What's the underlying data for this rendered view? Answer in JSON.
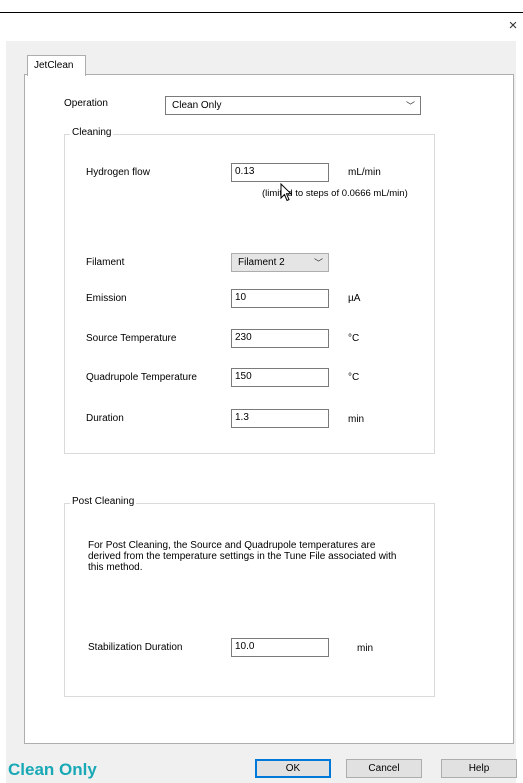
{
  "window": {
    "close_symbol": "×"
  },
  "tabs": [
    {
      "label": "JetClean"
    }
  ],
  "operation": {
    "label": "Operation",
    "value": "Clean Only"
  },
  "cleaning": {
    "title": "Cleaning",
    "hydrogen_flow": {
      "label": "Hydrogen flow",
      "value": "0.13",
      "unit": "mL/min",
      "note": "(limited to steps of 0.0666 mL/min)"
    },
    "filament": {
      "label": "Filament",
      "value": "Filament 2"
    },
    "emission": {
      "label": "Emission",
      "value": "10",
      "unit": "µA"
    },
    "source_temperature": {
      "label": "Source Temperature",
      "value": "230",
      "unit": "°C"
    },
    "quadrupole_temperature": {
      "label": "Quadrupole Temperature",
      "value": "150",
      "unit": "°C"
    },
    "duration": {
      "label": "Duration",
      "value": "1.3",
      "unit": "min"
    }
  },
  "post_cleaning": {
    "title": "Post Cleaning",
    "description": "For Post Cleaning, the Source and Quadrupole temperatures are derived from the temperature settings in the Tune File associated with this method.",
    "stabilization": {
      "label": "Stabilization Duration",
      "value": "10.0",
      "unit": "min"
    }
  },
  "status_text": "Clean Only",
  "buttons": {
    "ok": "OK",
    "cancel": "Cancel",
    "help": "Help"
  },
  "colors": {
    "status_text": "#19a9b6",
    "default_button_border": "#0078d7"
  },
  "icons": {
    "close": "close-icon",
    "chevron": "chevron-down-icon",
    "cursor": "mouse-cursor-icon"
  }
}
